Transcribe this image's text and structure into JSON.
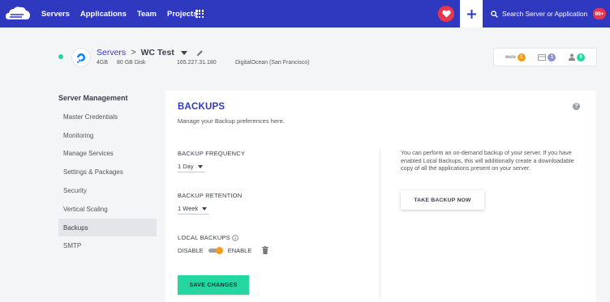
{
  "topbar": {
    "nav": [
      "Servers",
      "Applications",
      "Team",
      "Projects"
    ],
    "search_label": "Search Server or Application",
    "notification_badge": "99+",
    "icons": {
      "logo": "cloud-logo-icon",
      "apps": "grid-icon",
      "favorite": "heart-icon",
      "add": "plus-icon",
      "search": "search-icon"
    },
    "colors": {
      "bar": "#2f39bf",
      "heart": "#e8364f"
    }
  },
  "server": {
    "breadcrumb_root": "Servers",
    "separator": ">",
    "name": "WC Test",
    "ram": "4GB",
    "disk": "80 GB Disk",
    "ip": "165.227.31.180",
    "provider": "DigitalOcean (San Francisco)",
    "status_color": "#24d6a0",
    "stats": [
      {
        "label": "www",
        "count": "1",
        "color": "#f59c1a"
      },
      {
        "label": "",
        "count": "1",
        "color": "#8c8fd6"
      },
      {
        "label": "",
        "count": "0",
        "color": "#24d6a0"
      }
    ]
  },
  "sidebar": {
    "title": "Server Management",
    "items": [
      "Master Credentials",
      "Monitoring",
      "Manage Services",
      "Settings & Packages",
      "Security",
      "Vertical Scaling",
      "Backups",
      "SMTP"
    ],
    "active": "Backups"
  },
  "panel": {
    "title": "BACKUPS",
    "subtitle": "Manage your Backup preferences here.",
    "frequency_label": "BACKUP FREQUENCY",
    "frequency_value": "1 Day",
    "retention_label": "BACKUP RETENTION",
    "retention_value": "1 Week",
    "local_backups_label": "LOCAL BACKUPS",
    "disable_label": "DISABLE",
    "enable_label": "ENABLE",
    "local_backups_enabled": true,
    "save_label": "SAVE CHANGES",
    "info_text": "You can perform an on-demand backup of your server. If you have enabled Local Backups, this will additionally create a downloadable copy of all the applications present on your server.",
    "take_backup_label": "TAKE BACKUP NOW",
    "help_glyph": "?"
  }
}
